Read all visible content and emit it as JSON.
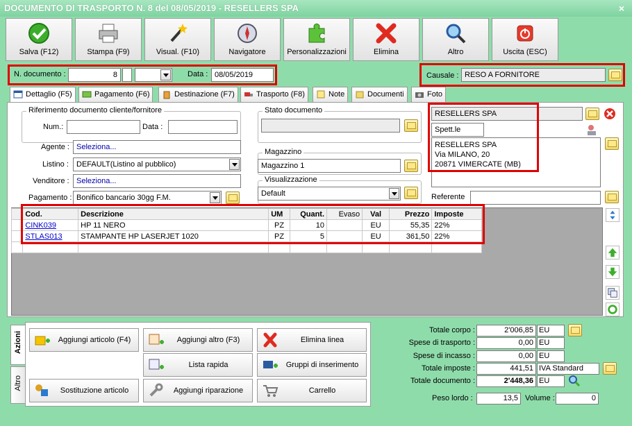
{
  "window": {
    "title": "DOCUMENTO DI TRASPORTO N. 8 del 08/05/2019 - RESELLERS SPA",
    "close": "×"
  },
  "toolbar": [
    {
      "label": "Salva (F12)",
      "icon": "check-icon"
    },
    {
      "label": "Stampa (F9)",
      "icon": "printer-icon"
    },
    {
      "label": "Visual. (F10)",
      "icon": "magic-wand-icon"
    },
    {
      "label": "Navigatore",
      "icon": "compass-icon"
    },
    {
      "label": "Personalizzazioni",
      "icon": "puzzle-icon"
    },
    {
      "label": "Elimina",
      "icon": "delete-x-icon"
    },
    {
      "label": "Altro",
      "icon": "magnifier-icon"
    },
    {
      "label": "Uscita (ESC)",
      "icon": "power-icon"
    }
  ],
  "header": {
    "numdoc_label": "N. documento :",
    "numdoc_value": "8",
    "data_label": "Data :",
    "data_value": "08/05/2019",
    "causale_label": "Causale :",
    "causale_value": "RESO A FORNITORE"
  },
  "tabs": [
    "Dettaglio (F5)",
    "Pagamento (F6)",
    "Destinazione (F7)",
    "Trasporto (F8)",
    "Note",
    "Documenti",
    "Foto"
  ],
  "rif": {
    "title": "Riferimento documento cliente/fornitore",
    "num_label": "Num.:",
    "data_label": "Data :"
  },
  "fields": {
    "agente_label": "Agente :",
    "agente_value": "Seleziona...",
    "listino_label": "Listino :",
    "listino_value": "DEFAULT(Listino al pubblico)",
    "venditore_label": "Venditore :",
    "venditore_value": "Seleziona...",
    "pagamento_label": "Pagamento :",
    "pagamento_value": "Bonifico bancario 30gg F.M."
  },
  "stato": {
    "title": "Stato documento"
  },
  "magazzino": {
    "title": "Magazzino",
    "value": "Magazzino 1"
  },
  "visualizzazione": {
    "title": "Visualizzazione",
    "value": "Default"
  },
  "cliente": {
    "name": "RESELLERS SPA",
    "spett": "Spett.le",
    "addr1": "RESELLERS SPA",
    "addr2": "Via MILANO, 20",
    "addr3": "20871 VIMERCATE (MB)",
    "referente_label": "Referente"
  },
  "grid": {
    "columns": [
      "Cod.",
      "Descrizione",
      "UM",
      "Quant.",
      "Evaso",
      "Val",
      "Prezzo",
      "Imposte"
    ],
    "rows": [
      [
        "CINK039",
        "HP 11 NERO",
        "PZ",
        "10",
        "",
        "EU",
        "55,35",
        "22%"
      ],
      [
        "STLAS013",
        "STAMPANTE HP LASERJET 1020",
        "PZ",
        "5",
        "",
        "EU",
        "361,50",
        "22%"
      ]
    ]
  },
  "azioni": {
    "tab_azioni": "Azioni",
    "tab_altro": "Altro",
    "buttons": [
      "Aggiungi articolo (F4)",
      "Aggiungi altro (F3)",
      "Elimina linea",
      "Lista rapida",
      "Gruppi di inserimento",
      "Sostituzione articolo",
      "Aggiungi riparazione",
      "Carrello"
    ]
  },
  "totali": {
    "corpo_label": "Totale corpo :",
    "corpo_value": "2'006,85",
    "corpo_unit": "EU",
    "trasporto_label": "Spese di trasporto :",
    "trasporto_value": "0,00",
    "trasporto_unit": "EU",
    "incasso_label": "Spese di incasso :",
    "incasso_value": "0,00",
    "incasso_unit": "EU",
    "imposte_label": "Totale imposte :",
    "imposte_value": "441,51",
    "imposte_unit": "IVA Standard",
    "documento_label": "Totale documento :",
    "documento_value": "2'448,36",
    "documento_unit": "EU",
    "peso_label": "Peso lordo :",
    "peso_value": "13,5",
    "volume_label": "Volume :",
    "volume_value": "0"
  }
}
